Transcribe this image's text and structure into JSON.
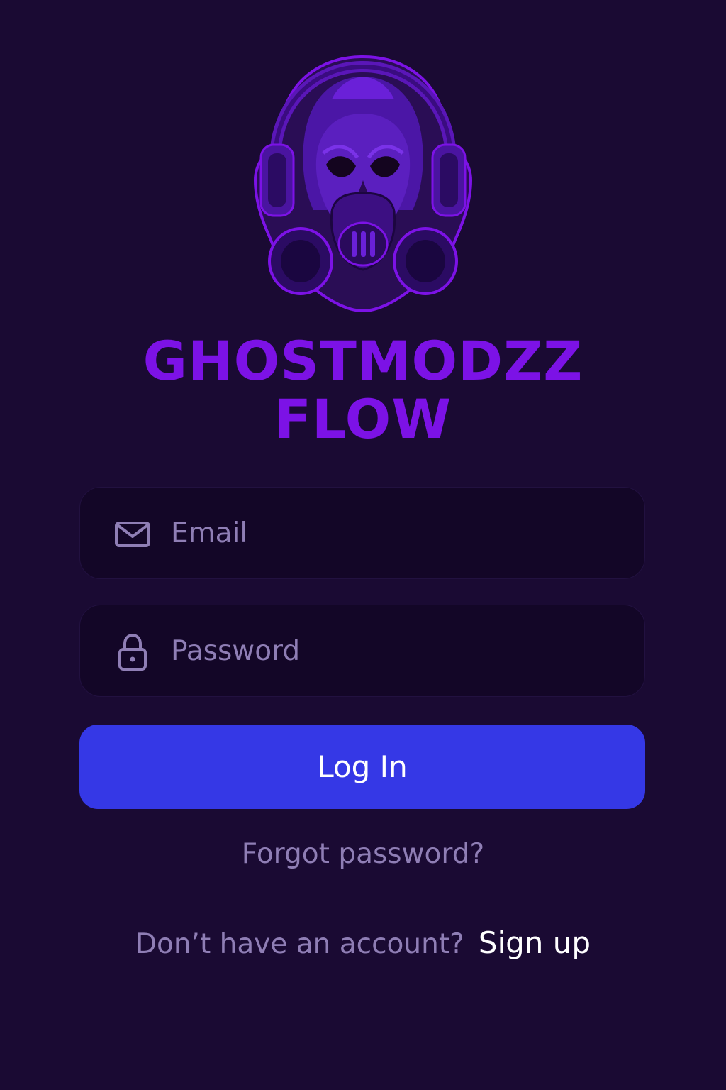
{
  "logo": {
    "icon": "gasmask-skull-headphones-icon",
    "accent_color": "#7c12e6"
  },
  "brand": {
    "line1": "GHOSTMODZZ",
    "line2": "FLOW"
  },
  "form": {
    "email": {
      "icon": "mail-icon",
      "placeholder": "Email",
      "value": ""
    },
    "password": {
      "icon": "lock-icon",
      "placeholder": "Password",
      "value": ""
    },
    "login_label": "Log In",
    "forgot_label": "Forgot password?"
  },
  "signup": {
    "prompt": "Don’t have an account?",
    "link_label": "Sign up"
  },
  "colors": {
    "background": "#1a0a33",
    "brand": "#7c12e6",
    "button": "#3538e6",
    "muted_text": "#8f7eb5"
  }
}
